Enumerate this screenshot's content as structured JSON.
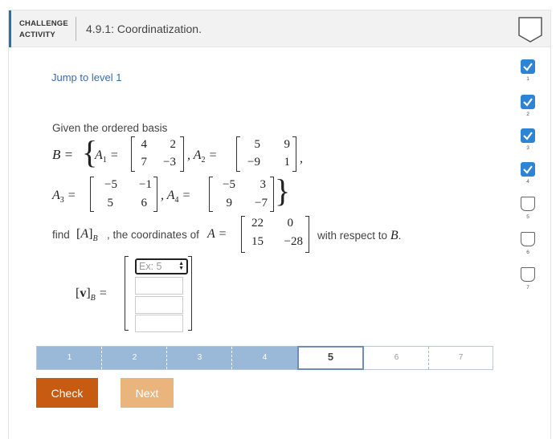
{
  "header": {
    "tag_line1": "CHALLENGE",
    "tag_line2": "ACTIVITY",
    "title": "4.9.1: Coordinatization."
  },
  "jump_link": "Jump to level 1",
  "problem": {
    "intro": "Given the ordered basis",
    "basis_symbol": "B",
    "matrices": {
      "A1": {
        "label": "A",
        "sub": "1",
        "rows": [
          [
            "4",
            "2"
          ],
          [
            "7",
            "−3"
          ]
        ]
      },
      "A2": {
        "label": "A",
        "sub": "2",
        "rows": [
          [
            "5",
            "9"
          ],
          [
            "−9",
            "1"
          ]
        ]
      },
      "A3": {
        "label": "A",
        "sub": "3",
        "rows": [
          [
            "−5",
            "−1"
          ],
          [
            "5",
            "6"
          ]
        ]
      },
      "A4": {
        "label": "A",
        "sub": "4",
        "rows": [
          [
            "−5",
            "3"
          ],
          [
            "9",
            "−7"
          ]
        ]
      },
      "A": {
        "label": "A",
        "rows": [
          [
            "22",
            "0"
          ],
          [
            "15",
            "−28"
          ]
        ]
      }
    },
    "find_text": "find",
    "coord_text": ", the coordinates of",
    "respect_text": "with respect to",
    "answer_label": "v"
  },
  "answer": {
    "placeholder": "Ex: 5"
  },
  "progress": {
    "levels": [
      "1",
      "2",
      "3",
      "4",
      "5",
      "6",
      "7"
    ],
    "current": 5
  },
  "buttons": {
    "check": "Check",
    "next": "Next"
  },
  "sidebar": {
    "levels": [
      {
        "num": "1",
        "status": "done"
      },
      {
        "num": "2",
        "status": "done"
      },
      {
        "num": "3",
        "status": "done"
      },
      {
        "num": "4",
        "status": "done"
      },
      {
        "num": "5",
        "status": "open"
      },
      {
        "num": "6",
        "status": "open"
      },
      {
        "num": "7",
        "status": "open"
      }
    ]
  },
  "colors": {
    "accent": "#2d6db5",
    "check_button": "#c75b12",
    "next_button": "#eab47d",
    "progress_done": "#9ab8d8",
    "sidebar_done": "#2d84d4"
  }
}
